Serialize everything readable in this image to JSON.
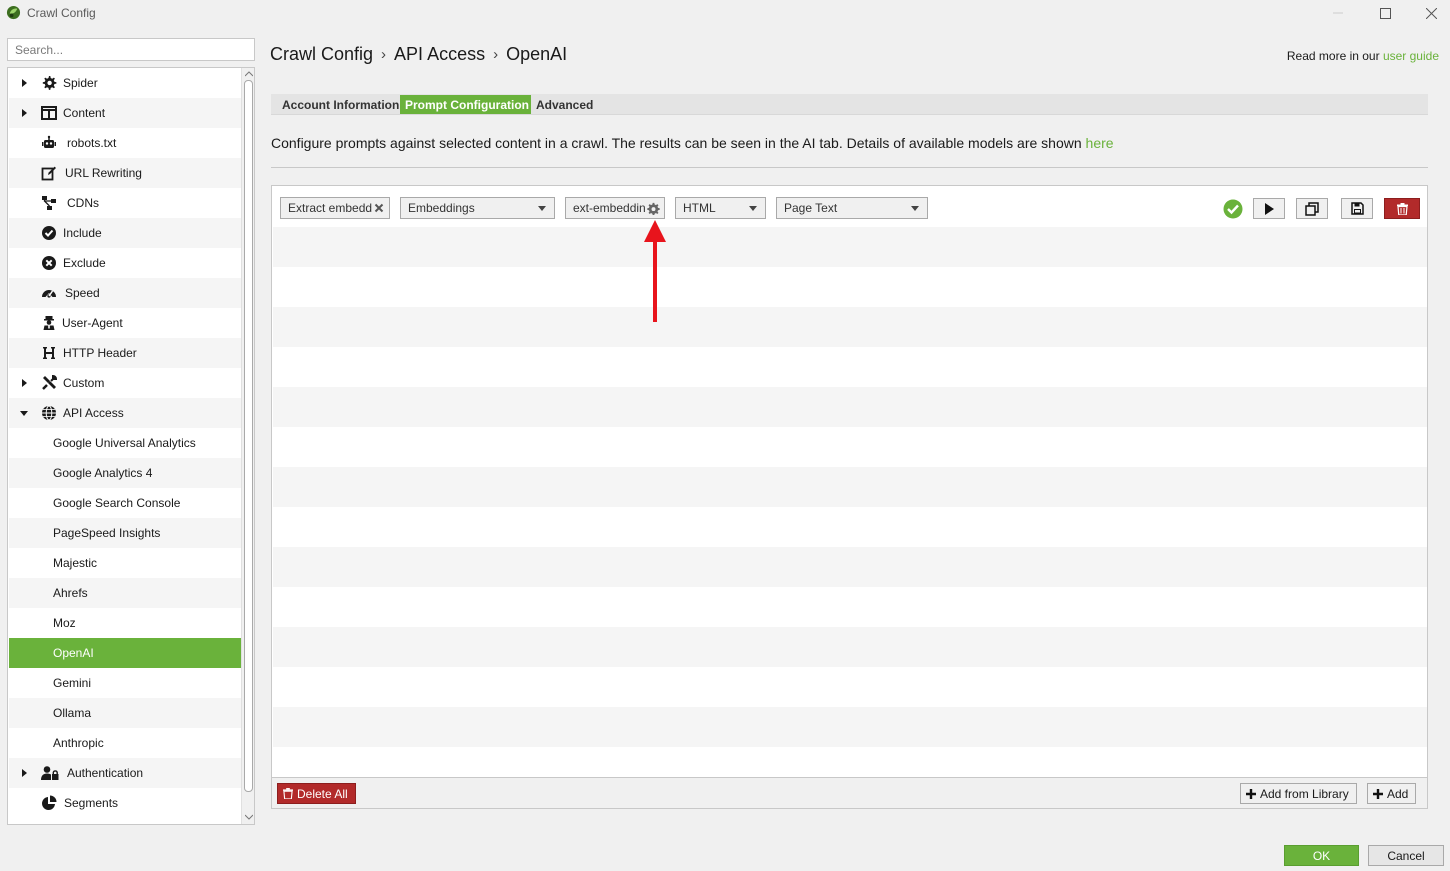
{
  "window": {
    "title": "Crawl Config"
  },
  "sidebar": {
    "search_placeholder": "Search...",
    "items": [
      {
        "label": "Spider",
        "icon": "gear-icon",
        "expandable": true
      },
      {
        "label": "Content",
        "icon": "columns-icon",
        "expandable": true
      },
      {
        "label": "robots.txt",
        "icon": "robot-icon"
      },
      {
        "label": "URL Rewriting",
        "icon": "edit-icon"
      },
      {
        "label": "CDNs",
        "icon": "network-icon"
      },
      {
        "label": "Include",
        "icon": "check-circle-icon"
      },
      {
        "label": "Exclude",
        "icon": "x-circle-icon"
      },
      {
        "label": "Speed",
        "icon": "gauge-icon"
      },
      {
        "label": "User-Agent",
        "icon": "agent-icon"
      },
      {
        "label": "HTTP Header",
        "icon": "header-h-icon"
      },
      {
        "label": "Custom",
        "icon": "tools-icon",
        "expandable": true
      },
      {
        "label": "API Access",
        "icon": "globe-icon",
        "expanded": true
      },
      {
        "label": "Google Universal Analytics"
      },
      {
        "label": "Google Analytics 4"
      },
      {
        "label": "Google Search Console"
      },
      {
        "label": "PageSpeed Insights"
      },
      {
        "label": "Majestic"
      },
      {
        "label": "Ahrefs"
      },
      {
        "label": "Moz"
      },
      {
        "label": "OpenAI",
        "selected": true
      },
      {
        "label": "Gemini"
      },
      {
        "label": "Ollama"
      },
      {
        "label": "Anthropic"
      },
      {
        "label": "Authentication",
        "icon": "user-lock-icon",
        "expandable": true
      },
      {
        "label": "Segments",
        "icon": "pie-chart-icon"
      }
    ]
  },
  "header": {
    "breadcrumb": [
      "Crawl Config",
      "API Access",
      "OpenAI"
    ],
    "read_more_prefix": "Read more in our",
    "read_more_link": "user guide"
  },
  "tabs": [
    {
      "label": "Account Information",
      "active": false
    },
    {
      "label": "Prompt Configuration",
      "active": true
    },
    {
      "label": "Advanced",
      "active": false
    }
  ],
  "description": {
    "text": "Configure prompts against selected content in a crawl. The results can be seen in the AI tab. Details of available models are shown",
    "link": "here"
  },
  "prompt_row": {
    "name_value": "Extract embedd",
    "type_value": "Embeddings",
    "model_value": "ext-embeddin",
    "format_value": "HTML",
    "content_value": "Page Text",
    "status": "valid"
  },
  "footer_buttons": {
    "delete_all": "Delete All",
    "add_from_library": "Add from Library",
    "add": "Add"
  },
  "dialog_buttons": {
    "ok": "OK",
    "cancel": "Cancel"
  },
  "colors": {
    "accent": "#6ab23b",
    "danger": "#b22a2a",
    "annotation_arrow": "#e8141c"
  }
}
